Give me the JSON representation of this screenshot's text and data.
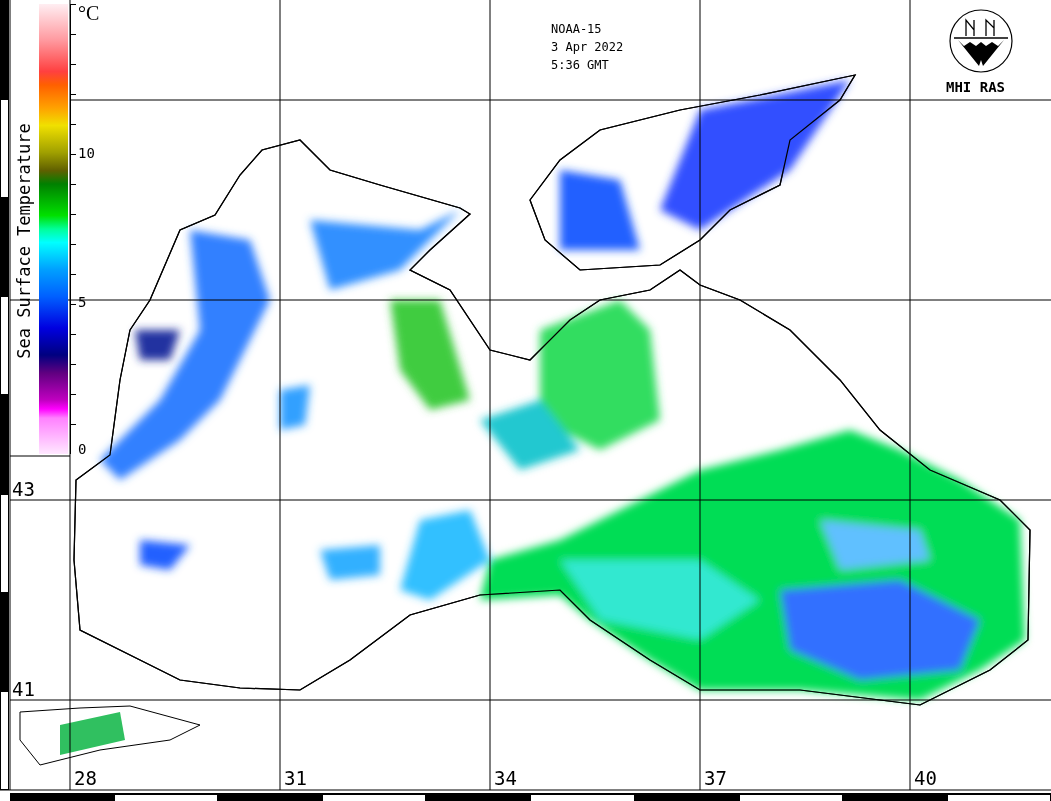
{
  "header": {
    "satellite": "NOAA-15",
    "date": "3 Apr 2022",
    "time": "5:36 GMT"
  },
  "legend": {
    "title": "Sea Surface Temperature",
    "unit": "°C",
    "ticks": [
      "10",
      "5",
      "0"
    ]
  },
  "logo": {
    "label": "MHI RAS"
  },
  "latitude_labels": [
    "43",
    "41"
  ],
  "longitude_labels": [
    "28",
    "31",
    "34",
    "37",
    "40"
  ]
}
